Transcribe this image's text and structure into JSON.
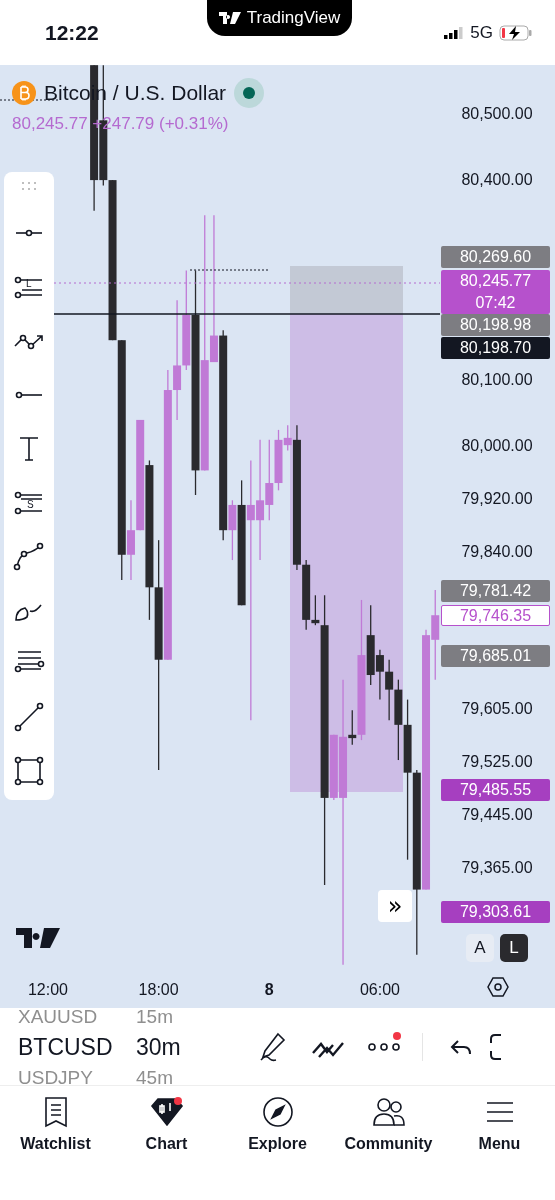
{
  "status_bar": {
    "time": "12:22",
    "app_pill": "TradingView",
    "network": "5G"
  },
  "chart": {
    "symbol_title": "Bitcoin / U.S. Dollar",
    "price_line": "80,245.77 +247.79 (+0.31%)",
    "price_axis": [
      {
        "kind": "badge",
        "label": "80,269.60",
        "color": "#7d7d82"
      },
      {
        "kind": "badge",
        "label": "80,245.77",
        "sublabel": "07:42",
        "color": "#b651cc"
      },
      {
        "kind": "badge",
        "label": "80,198.98",
        "color": "#7d7d82"
      },
      {
        "kind": "badge",
        "label": "80,198.70",
        "color": "#131722"
      },
      {
        "kind": "badge",
        "label": "79,781.42",
        "color": "#7d7d82"
      },
      {
        "kind": "outline",
        "label": "79,746.35",
        "color": "#b651cc"
      },
      {
        "kind": "badge",
        "label": "79,685.01",
        "color": "#7d7d82"
      },
      {
        "kind": "badge",
        "label": "79,485.55",
        "color": "#a63fc0"
      },
      {
        "kind": "badge",
        "label": "79,303.61",
        "color": "#a63fc0"
      }
    ],
    "chart_data": {
      "type": "candlestick",
      "ylim": [
        79365,
        80500
      ],
      "categories": [
        "12:00",
        null,
        null,
        null,
        null,
        null,
        null,
        null,
        null,
        null,
        null,
        null,
        "18:00",
        null,
        null,
        null,
        null,
        null,
        null,
        null,
        null,
        null,
        null,
        null,
        "8",
        null,
        null,
        null,
        null,
        null,
        null,
        null,
        null,
        null,
        null,
        null,
        "06:00",
        null,
        null,
        null,
        null,
        null,
        null
      ],
      "yticks": [
        {
          "value": 80500,
          "label": "80,500.00"
        },
        {
          "value": 80400,
          "label": "80,400.00"
        },
        {
          "value": 80100,
          "label": "80,100.00"
        },
        {
          "value": 80000,
          "label": "80,000.00"
        },
        {
          "value": 79920,
          "label": "79,920.00"
        },
        {
          "value": 79840,
          "label": "79,840.00"
        },
        {
          "value": 79605,
          "label": "79,605.00"
        },
        {
          "value": 79525,
          "label": "79,525.00"
        },
        {
          "value": 79445,
          "label": "79,445.00"
        },
        {
          "value": 79365,
          "label": "79,365.00"
        }
      ],
      "ohlc": [
        null,
        null,
        null,
        null,
        null,
        [
          80572,
          80572,
          80353,
          80399
        ],
        [
          80489,
          80572,
          80391,
          80399
        ],
        [
          80399,
          80399,
          80158,
          80158
        ],
        [
          80158,
          80158,
          79797,
          79835
        ],
        [
          79835,
          79917,
          79797,
          79872
        ],
        [
          79872,
          80038,
          79872,
          80038
        ],
        [
          79970,
          79977,
          79737,
          79786
        ],
        [
          79786,
          79857,
          79511,
          79677
        ],
        [
          79677,
          80113,
          79677,
          80083
        ],
        [
          80083,
          80218,
          80038,
          80120
        ],
        [
          80120,
          80263,
          80113,
          80196
        ],
        [
          80196,
          80263,
          79925,
          79962
        ],
        [
          79962,
          80346,
          79962,
          80128
        ],
        [
          80125,
          80346,
          80125,
          80165
        ],
        [
          80165,
          80173,
          79857,
          79872
        ],
        [
          79872,
          79917,
          79827,
          79910
        ],
        [
          79910,
          79947,
          79759,
          79759
        ],
        [
          79887,
          79977,
          79586,
          79910
        ],
        [
          79887,
          80008,
          79827,
          79917
        ],
        [
          79910,
          80008,
          79887,
          79943
        ],
        [
          79943,
          80023,
          79932,
          80008
        ],
        [
          80000,
          80030,
          79992,
          80011
        ],
        [
          80008,
          80030,
          79812,
          79820
        ],
        [
          79820,
          79827,
          79722,
          79737
        ],
        [
          79737,
          79774,
          79729,
          79732
        ],
        [
          79729,
          79774,
          79338,
          79469
        ],
        [
          79469,
          79564,
          79466,
          79564
        ],
        [
          79469,
          79647,
          79218,
          79561
        ],
        [
          79564,
          79601,
          79549,
          79559
        ],
        [
          79564,
          79767,
          79556,
          79684
        ],
        [
          79714,
          79759,
          79639,
          79654
        ],
        [
          79684,
          79692,
          79617,
          79659
        ],
        [
          79659,
          79677,
          79586,
          79632
        ],
        [
          79632,
          79647,
          79526,
          79579
        ],
        [
          79579,
          79617,
          79376,
          79507
        ],
        [
          79507,
          79511,
          79233,
          79331
        ],
        [
          79331,
          79722,
          79331,
          79714
        ],
        [
          79707,
          79782,
          79647,
          79744
        ]
      ]
    },
    "time_label_bold": [
      false,
      false,
      true,
      false
    ],
    "scroll_button": "»",
    "scale_modes": [
      {
        "label": "A",
        "selected": false
      },
      {
        "label": "L",
        "selected": true
      }
    ],
    "drawing_tools": [
      {
        "kind": "horizontal-line"
      },
      {
        "kind": "horizontal-ray-label",
        "label": "L"
      },
      {
        "kind": "trend-path"
      },
      {
        "kind": "horizontal-ray"
      },
      {
        "kind": "text"
      },
      {
        "kind": "parallel-label",
        "label": "S"
      },
      {
        "kind": "curve"
      },
      {
        "kind": "brush"
      },
      {
        "kind": "fib"
      },
      {
        "kind": "trend-line"
      },
      {
        "kind": "rectangle"
      }
    ]
  },
  "symbol_bar": {
    "symbols": [
      {
        "label": "XAUUSD",
        "selected": false
      },
      {
        "label": "BTCUSD",
        "selected": true
      },
      {
        "label": "USDJPY",
        "selected": false
      }
    ],
    "intervals": [
      {
        "label": "15m",
        "selected": false
      },
      {
        "label": "30m",
        "selected": true
      },
      {
        "label": "45m",
        "selected": false
      }
    ],
    "more_badge": true
  },
  "nav": [
    {
      "kind": "watchlist",
      "label": "Watchlist",
      "selected": false,
      "badge": false
    },
    {
      "kind": "chart",
      "label": "Chart",
      "selected": true,
      "badge": true
    },
    {
      "kind": "explore",
      "label": "Explore",
      "selected": false,
      "badge": false
    },
    {
      "kind": "community",
      "label": "Community",
      "selected": false,
      "badge": false
    },
    {
      "kind": "menu",
      "label": "Menu",
      "selected": false,
      "badge": false
    }
  ]
}
